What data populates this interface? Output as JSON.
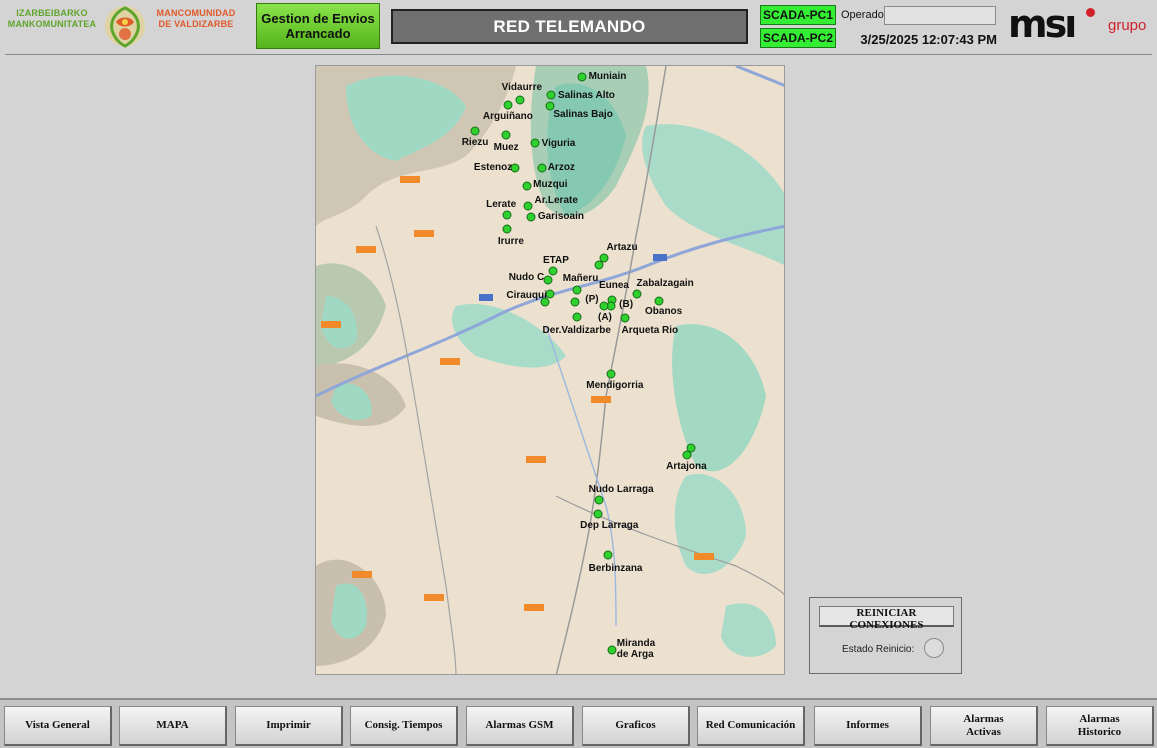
{
  "header": {
    "logo_left": "IZARBEIBARKO MANKOMUNITATEA",
    "logo_right": "MANCOMUNIDAD DE VALDIZARBE",
    "status_line1": "Gestion de Envios",
    "status_line2": "Arrancado",
    "title": "RED TELEMANDO",
    "scada1": "SCADA-PC1",
    "scada2": "SCADA-PC2",
    "operator_label": "Operador:",
    "operator_value": "",
    "datetime": "3/25/2025 12:07:43 PM",
    "brand": "msı",
    "brand_suffix": "grupo",
    "colors": {
      "status_green": "#55b51c",
      "scada_green": "#33ee33",
      "brand_red": "#d0202a"
    }
  },
  "map": {
    "sites": [
      {
        "name": "Muniain",
        "dx": 0.565,
        "dy": 0.018,
        "lx": 0.58,
        "ly": 0.008
      },
      {
        "name": "Vidaurre",
        "dx": 0.435,
        "dy": 0.056,
        "lx": 0.395,
        "ly": 0.027
      },
      {
        "name": "Salinas Alto",
        "dx": 0.5,
        "dy": 0.048,
        "lx": 0.515,
        "ly": 0.04
      },
      {
        "name": "Salinas Bajo",
        "dx": 0.498,
        "dy": 0.065,
        "lx": 0.505,
        "ly": 0.07
      },
      {
        "name": "Arguiñano",
        "dx": 0.408,
        "dy": 0.064,
        "lx": 0.355,
        "ly": 0.074
      },
      {
        "name": "Riezu",
        "dx": 0.338,
        "dy": 0.107,
        "lx": 0.31,
        "ly": 0.117
      },
      {
        "name": "Muez",
        "dx": 0.405,
        "dy": 0.113,
        "lx": 0.378,
        "ly": 0.124
      },
      {
        "name": "Viguria",
        "dx": 0.465,
        "dy": 0.127,
        "lx": 0.48,
        "ly": 0.118
      },
      {
        "name": "Estenoz",
        "dx": 0.423,
        "dy": 0.168,
        "lx": 0.336,
        "ly": 0.157
      },
      {
        "name": "Arzoz",
        "dx": 0.48,
        "dy": 0.167,
        "lx": 0.493,
        "ly": 0.157
      },
      {
        "name": "Muzqui",
        "dx": 0.448,
        "dy": 0.196,
        "lx": 0.462,
        "ly": 0.186
      },
      {
        "name": "Lerate",
        "dx": 0.406,
        "dy": 0.244,
        "lx": 0.362,
        "ly": 0.218
      },
      {
        "name": "Ar.Lerate",
        "dx": 0.451,
        "dy": 0.23,
        "lx": 0.465,
        "ly": 0.212
      },
      {
        "name": "Garisoain",
        "dx": 0.457,
        "dy": 0.248,
        "lx": 0.472,
        "ly": 0.238
      },
      {
        "name": "Irurre",
        "dx": 0.406,
        "dy": 0.268,
        "lx": 0.387,
        "ly": 0.278
      },
      {
        "name": "Artazu",
        "dx": 0.612,
        "dy": 0.315,
        "lx": 0.618,
        "ly": 0.289
      },
      {
        "name": "Artazu",
        "dx": 0.603,
        "dy": 0.327,
        "lx": 0.618,
        "ly": 0.289
      },
      {
        "name": "ETAP",
        "dx": 0.505,
        "dy": 0.336,
        "lx": 0.483,
        "ly": 0.31
      },
      {
        "name": "Nudo C",
        "dx": 0.493,
        "dy": 0.35,
        "lx": 0.41,
        "ly": 0.338
      },
      {
        "name": "Mañeru",
        "dx": 0.555,
        "dy": 0.368,
        "lx": 0.525,
        "ly": 0.34
      },
      {
        "name": "Eunea",
        "dx": 0.63,
        "dy": 0.383,
        "lx": 0.602,
        "ly": 0.351
      },
      {
        "name": "Zabalzagain",
        "dx": 0.682,
        "dy": 0.374,
        "lx": 0.682,
        "ly": 0.348
      },
      {
        "name": "Cirauqui",
        "dx": 0.497,
        "dy": 0.374,
        "lx": 0.405,
        "ly": 0.367
      },
      {
        "name": "(P)",
        "dx": 0.552,
        "dy": 0.387,
        "lx": 0.573,
        "ly": 0.373
      },
      {
        "name": "(B)",
        "dx": 0.628,
        "dy": 0.393,
        "lx": 0.645,
        "ly": 0.382
      },
      {
        "name": "Obanos",
        "dx": 0.73,
        "dy": 0.385,
        "lx": 0.7,
        "ly": 0.393
      },
      {
        "name": "(A)",
        "dx": 0.613,
        "dy": 0.393,
        "lx": 0.6,
        "ly": 0.403
      },
      {
        "name": "Cirauqui",
        "dx": 0.488,
        "dy": 0.387,
        "lx": 0.405,
        "ly": 0.367
      },
      {
        "name": "Der.Valdizarbe",
        "dx": 0.555,
        "dy": 0.412,
        "lx": 0.482,
        "ly": 0.424
      },
      {
        "name": "Arqueta Rio",
        "dx": 0.657,
        "dy": 0.413,
        "lx": 0.65,
        "ly": 0.424
      },
      {
        "name": "Mendigorria",
        "dx": 0.627,
        "dy": 0.505,
        "lx": 0.575,
        "ly": 0.514
      },
      {
        "name": "Artajona",
        "dx": 0.798,
        "dy": 0.627,
        "lx": 0.745,
        "ly": 0.647
      },
      {
        "name": "Artajona",
        "dx": 0.79,
        "dy": 0.637,
        "lx": 0.745,
        "ly": 0.647
      },
      {
        "name": "Nudo Larraga",
        "dx": 0.602,
        "dy": 0.711,
        "lx": 0.58,
        "ly": 0.686
      },
      {
        "name": "Dep Larraga",
        "dx": 0.6,
        "dy": 0.734,
        "lx": 0.562,
        "ly": 0.744
      },
      {
        "name": "Berbinzana",
        "dx": 0.622,
        "dy": 0.802,
        "lx": 0.58,
        "ly": 0.815
      },
      {
        "name": "Miranda de Arga",
        "dx": 0.63,
        "dy": 0.957,
        "lx": 0.64,
        "ly": 0.938
      }
    ]
  },
  "reset": {
    "button_label": "REINICIAR CONEXIONES",
    "status_label": "Estado Reinicio:"
  },
  "nav": [
    {
      "label": "Vista General"
    },
    {
      "label": "MAPA"
    },
    {
      "label": "Imprimir"
    },
    {
      "label": "Consig. Tiempos"
    },
    {
      "label": "Alarmas GSM"
    },
    {
      "label": "Graficos"
    },
    {
      "label": "Red Comunicación"
    },
    {
      "label": "Informes"
    },
    {
      "label": "Alarmas Activas"
    },
    {
      "label": "Alarmas Historico"
    }
  ]
}
